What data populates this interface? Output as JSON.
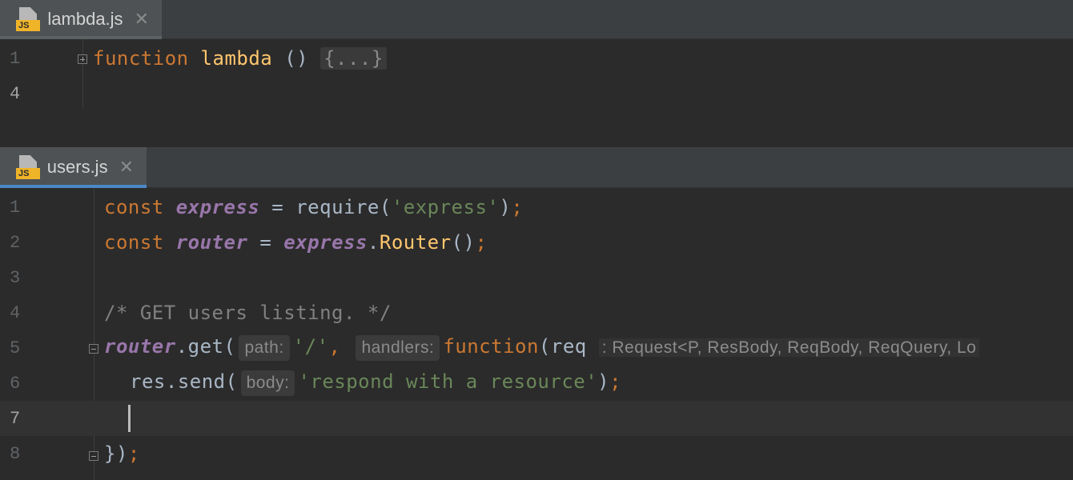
{
  "panes": [
    {
      "tab": {
        "title": "lambda.js",
        "icon": "js-file-icon",
        "active": false,
        "underline": "#5c6164"
      },
      "lines": [
        {
          "num": "1"
        },
        {
          "num": "4"
        }
      ],
      "folded_line": {
        "keyword": "function",
        "name": "lambda",
        "parens": "()",
        "folded": "{...}"
      }
    },
    {
      "tab": {
        "title": "users.js",
        "icon": "js-file-icon",
        "active": true,
        "underline": "#4a88c7"
      },
      "lines": [
        {
          "num": "1"
        },
        {
          "num": "2"
        },
        {
          "num": "3"
        },
        {
          "num": "4"
        },
        {
          "num": "5"
        },
        {
          "num": "6"
        },
        {
          "num": "7"
        },
        {
          "num": "8"
        }
      ],
      "code": {
        "l1": {
          "kw": "const",
          "var": "express",
          "eq": " = ",
          "call": "require(",
          "str": "'express'",
          "close": ");"
        },
        "l2": {
          "kw": "const",
          "var": "router",
          "eq": " = ",
          "obj": "express",
          "dot": ".",
          "fn": "Router",
          "close": "();"
        },
        "l4": {
          "comment": "/* GET users listing. */"
        },
        "l5": {
          "obj": "router",
          "dot": ".",
          "method": "get(",
          "hint_path": "path:",
          "str": "'/'",
          "comma": ",",
          "hint_handlers": "handlers:",
          "kw": "function",
          "paren": "(",
          "param": "req",
          "typehint": ": Request<P, ResBody, ReqBody, ReqQuery, Lo"
        },
        "l6": {
          "obj": "res",
          "dot": ".",
          "method": "send(",
          "hint_body": "body:",
          "str": "'respond with a resource'",
          "close": ");"
        },
        "l8": {
          "brace": "})",
          "semi": ";"
        }
      }
    }
  ],
  "colors": {
    "keyword": "#cc7832",
    "function": "#ffc66d",
    "variable": "#9876aa",
    "string": "#6a8759",
    "comment": "#808080",
    "text": "#a9b7c6"
  }
}
